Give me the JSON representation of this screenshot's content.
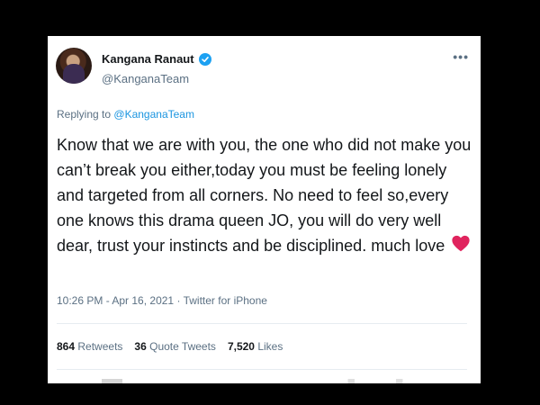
{
  "tweet": {
    "author_name": "Kangana Ranaut",
    "handle": "@KanganaTeam",
    "more_label": "•••",
    "reply_prefix": "Replying to",
    "reply_mention": "@KanganaTeam",
    "text": "Know that we are with you, the one who did not make you can’t break you either,today you must be feeling lonely and targeted from all corners. No need to feel so,every one knows this drama queen JO, you will do very well dear, trust your instincts and be disciplined. much love",
    "timestamp": "10:26 PM - Apr 16, 2021",
    "separator": "·",
    "source": "Twitter for iPhone"
  },
  "stats": {
    "retweets_count": "864",
    "retweets_label": "Retweets",
    "quotes_count": "36",
    "quotes_label": "Quote Tweets",
    "likes_count": "7,520",
    "likes_label": "Likes"
  },
  "colors": {
    "verified": "#1da1f2",
    "mention": "#1b95e0",
    "heart": "#e0245e",
    "background": "#000000"
  },
  "icons": {
    "verified": "verified-badge-icon",
    "heart": "heart-icon",
    "more": "more-icon"
  }
}
